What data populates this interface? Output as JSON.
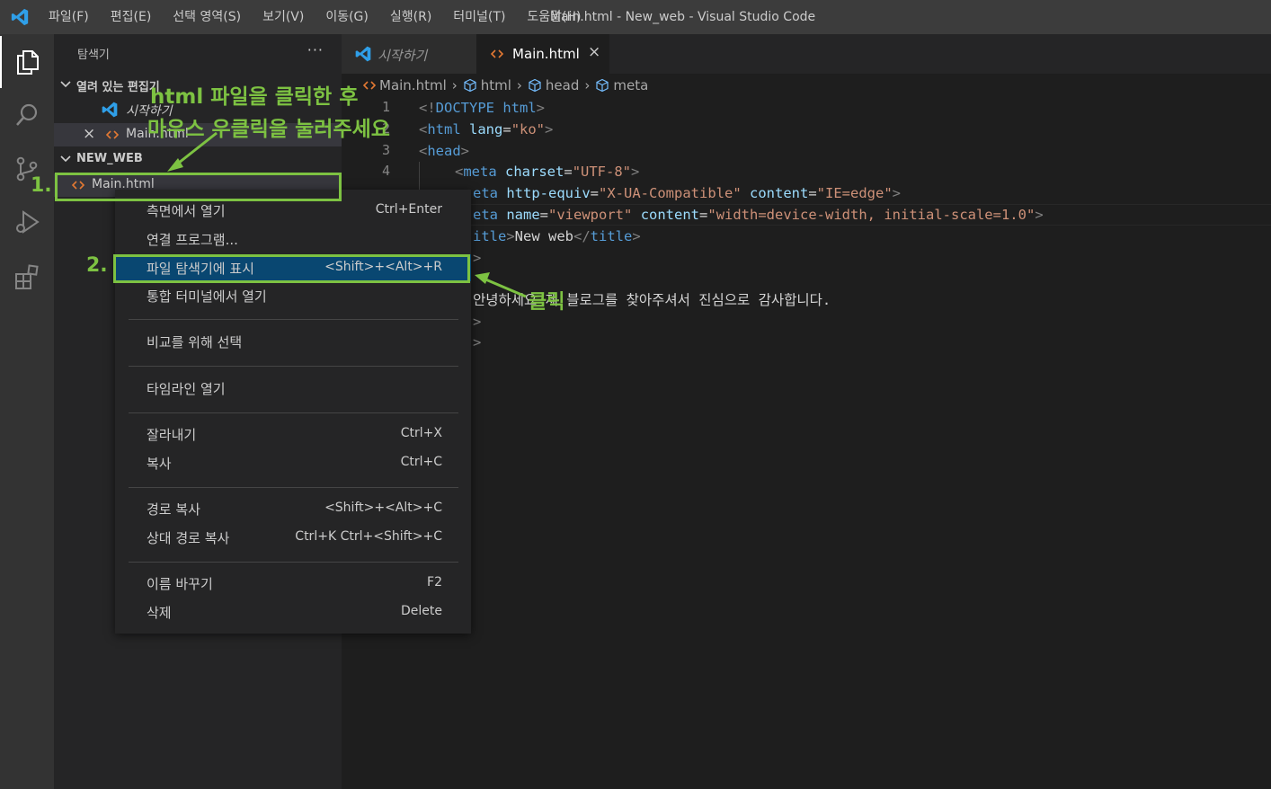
{
  "app": {
    "window_title": "Main.html - New_web - Visual Studio Code",
    "menu": [
      "파일(F)",
      "편집(E)",
      "선택 영역(S)",
      "보기(V)",
      "이동(G)",
      "실행(R)",
      "터미널(T)",
      "도움말(H)"
    ]
  },
  "activity_bar": {
    "icons": [
      "explorer-icon",
      "search-icon",
      "source-control-icon",
      "run-debug-icon",
      "extensions-icon"
    ]
  },
  "sidebar": {
    "title": "탐색기",
    "more": "···",
    "open_editors": {
      "label": "열려 있는 편집기",
      "items": [
        {
          "name": "시작하기",
          "icon": "vscode-icon"
        },
        {
          "name": "Main.html",
          "icon": "html-file-icon",
          "close": "×"
        }
      ]
    },
    "workspace": {
      "label": "NEW_WEB",
      "files": [
        {
          "name": "Main.html",
          "icon": "html-file-icon"
        }
      ]
    }
  },
  "tabs": [
    {
      "label": "시작하기",
      "active": false
    },
    {
      "label": "Main.html",
      "active": true,
      "close": "×"
    }
  ],
  "breadcrumbs": [
    "Main.html",
    "html",
    "head",
    "meta"
  ],
  "editor": {
    "line_numbers": [
      "1",
      "2",
      "3",
      "4"
    ],
    "lines": {
      "l1": {
        "lt": "<!",
        "tag": "DOCTYPE",
        "attr": "html",
        "gt": ">"
      },
      "l2": {
        "lt": "<",
        "tag": "html",
        "attr": "lang",
        "eq": "=",
        "val": "\"ko\"",
        "gt": ">"
      },
      "l3": {
        "lt": "<",
        "tag": "head",
        "gt": ">"
      },
      "l4": {
        "lt": "<",
        "tag": "meta",
        "attr": "charset",
        "eq": "=",
        "val": "\"UTF-8\"",
        "gt": ">"
      },
      "l5": {
        "tag": "eta",
        "attr1": "http-equiv",
        "eq": "=",
        "val1": "\"X-UA-Compatible\"",
        "attr2": "content",
        "val2": "\"IE=edge\"",
        "gt": ">"
      },
      "l6": {
        "tag": "eta",
        "attr1": "name",
        "eq": "=",
        "val1": "\"viewport\"",
        "attr2": "content",
        "val2": "\"width=device-width, initial-scale=1.0\"",
        "gt": ">"
      },
      "l7": {
        "tag": "itle",
        "gt": ">",
        "text": "New web",
        "close_lt": "</",
        "close_tag": "title"
      },
      "l8": {
        "gt": ">"
      },
      "l10": {
        "text": "안녕하세요 제 블로그를 찾아주셔서 진심으로 감사합니다."
      },
      "l11": {
        "gt": ">"
      },
      "l12": {
        "gt": ">"
      }
    }
  },
  "context_menu": {
    "items": [
      {
        "label": "측면에서 열기",
        "shortcut": "Ctrl+Enter"
      },
      {
        "label": "연결 프로그램...",
        "shortcut": ""
      },
      {
        "label": "파일 탐색기에 표시",
        "shortcut": "<Shift>+<Alt>+R"
      },
      {
        "label": "통합 터미널에서 열기",
        "shortcut": ""
      },
      {
        "label": "비교를 위해 선택",
        "shortcut": ""
      },
      {
        "label": "타임라인 열기",
        "shortcut": ""
      },
      {
        "label": "잘라내기",
        "shortcut": "Ctrl+X"
      },
      {
        "label": "복사",
        "shortcut": "Ctrl+C"
      },
      {
        "label": "경로 복사",
        "shortcut": "<Shift>+<Alt>+C"
      },
      {
        "label": "상대 경로 복사",
        "shortcut": "Ctrl+K Ctrl+<Shift>+C"
      },
      {
        "label": "이름 바꾸기",
        "shortcut": "F2"
      },
      {
        "label": "삭제",
        "shortcut": "Delete"
      }
    ]
  },
  "annotations": {
    "instruction_line1": "html 파일을 클릭한 후",
    "instruction_line2": "마우스 우클릭을 눌러주세요",
    "step1": "1.",
    "step2": "2.",
    "click_label": "클릭",
    "color": "#7dc242"
  }
}
